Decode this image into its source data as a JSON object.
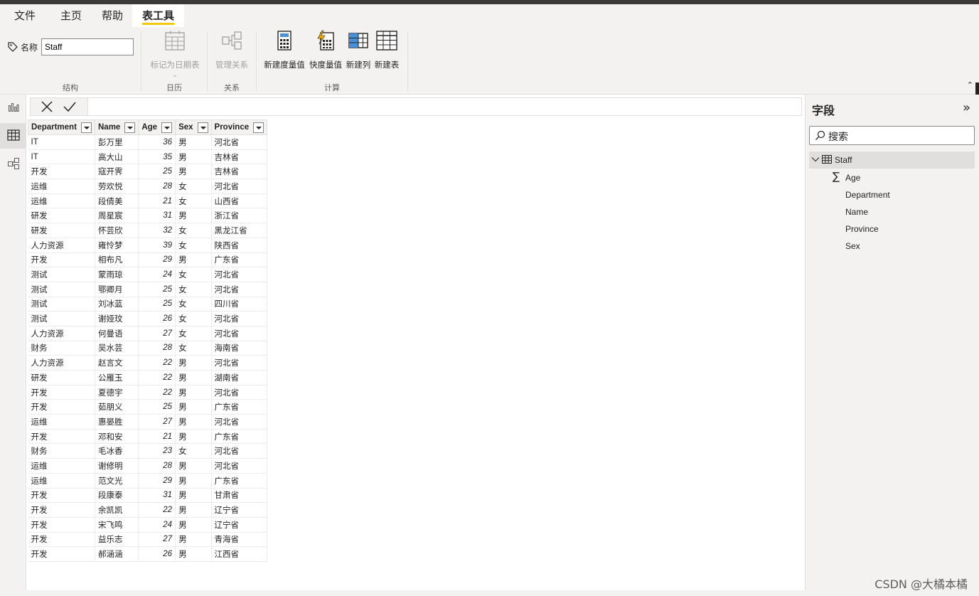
{
  "menu": {
    "tabs": [
      "文件",
      "主页",
      "帮助",
      "表工具"
    ],
    "active_tab": "表工具"
  },
  "ribbon": {
    "name_label": "名称",
    "name_value": "Staff",
    "groups": {
      "structure": "结构",
      "calendar": "日历",
      "relationships": "关系",
      "calculations": "计算"
    },
    "buttons": {
      "mark_as_date_table": "标记为日期表",
      "manage_relationships": "管理关系",
      "new_measure": "新建度量值",
      "quick_measure": "快度量值",
      "new_column": "新建列",
      "new_table": "新建表"
    }
  },
  "table": {
    "columns": [
      "Department",
      "Name",
      "Age",
      "Sex",
      "Province"
    ],
    "rows": [
      [
        "IT",
        "彭万里",
        "36",
        "男",
        "河北省"
      ],
      [
        "IT",
        "高大山",
        "35",
        "男",
        "吉林省"
      ],
      [
        "开发",
        "寇开霁",
        "25",
        "男",
        "吉林省"
      ],
      [
        "运维",
        "劳欢悦",
        "28",
        "女",
        "河北省"
      ],
      [
        "运维",
        "段倩美",
        "21",
        "女",
        "山西省"
      ],
      [
        "研发",
        "周星宸",
        "31",
        "男",
        "浙江省"
      ],
      [
        "研发",
        "怀芸欣",
        "32",
        "女",
        "黑龙江省"
      ],
      [
        "人力资源",
        "雍怜梦",
        "39",
        "女",
        "陕西省"
      ],
      [
        "开发",
        "相布凡",
        "29",
        "男",
        "广东省"
      ],
      [
        "测试",
        "蒙雨琼",
        "24",
        "女",
        "河北省"
      ],
      [
        "测试",
        "鄂卿月",
        "25",
        "女",
        "河北省"
      ],
      [
        "测试",
        "刘冰蓝",
        "25",
        "女",
        "四川省"
      ],
      [
        "测试",
        "谢娅玟",
        "26",
        "女",
        "河北省"
      ],
      [
        "人力资源",
        "何曼语",
        "27",
        "女",
        "河北省"
      ],
      [
        "财务",
        "吴水芸",
        "28",
        "女",
        "海南省"
      ],
      [
        "人力资源",
        "赵言文",
        "22",
        "男",
        "河北省"
      ],
      [
        "研发",
        "公雁玉",
        "22",
        "男",
        "湖南省"
      ],
      [
        "开发",
        "夏德宇",
        "22",
        "男",
        "河北省"
      ],
      [
        "开发",
        "茹朋义",
        "25",
        "男",
        "广东省"
      ],
      [
        "运维",
        "惠晏胜",
        "27",
        "男",
        "河北省"
      ],
      [
        "开发",
        "邓和安",
        "21",
        "男",
        "广东省"
      ],
      [
        "财务",
        "毛冰香",
        "23",
        "女",
        "河北省"
      ],
      [
        "运维",
        "谢修明",
        "28",
        "男",
        "河北省"
      ],
      [
        "运维",
        "范文光",
        "29",
        "男",
        "广东省"
      ],
      [
        "开发",
        "段康泰",
        "31",
        "男",
        "甘肃省"
      ],
      [
        "开发",
        "余凯凯",
        "22",
        "男",
        "辽宁省"
      ],
      [
        "开发",
        "宋飞鸣",
        "24",
        "男",
        "辽宁省"
      ],
      [
        "开发",
        "益乐志",
        "27",
        "男",
        "青海省"
      ],
      [
        "开发",
        "郝涵涵",
        "26",
        "男",
        "江西省"
      ]
    ]
  },
  "fields_pane": {
    "title": "字段",
    "search_placeholder": "搜索",
    "table_name": "Staff",
    "fields": [
      "Age",
      "Department",
      "Name",
      "Province",
      "Sex"
    ]
  },
  "watermark": "CSDN @大橘本橘",
  "colors": {
    "accent": "#f2c811",
    "ribbon_bg": "#f3f2f1",
    "grid_border": "#e1dfdd"
  }
}
